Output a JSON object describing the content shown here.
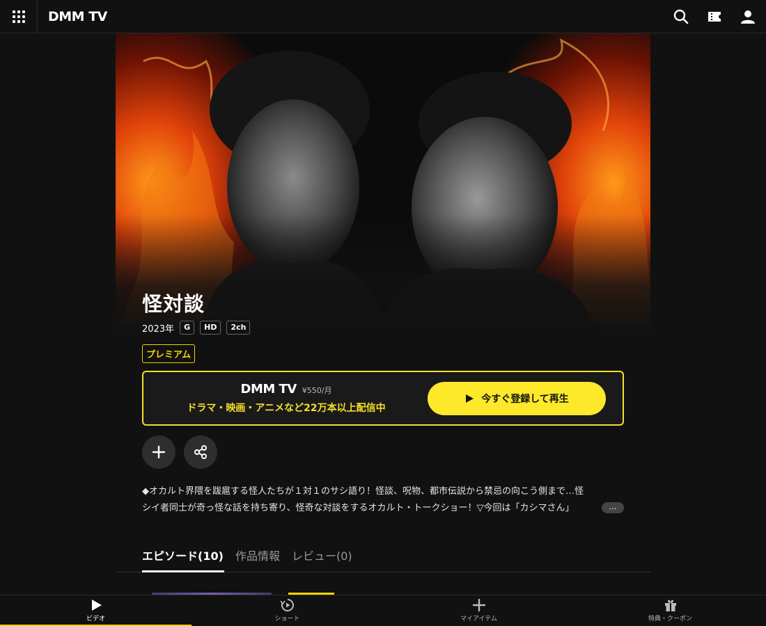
{
  "header": {
    "logo": "DMM TV",
    "icons": [
      "search-icon",
      "ticket-icon",
      "user-icon"
    ]
  },
  "title": {
    "text": "怪対談",
    "year": "2023年",
    "tags": [
      "G",
      "HD",
      "2ch"
    ],
    "premium": "プレミアム"
  },
  "signup": {
    "logo": "DMM TV",
    "price": "¥550/月",
    "desc": "ドラマ・映画・アニメなど22万本以上配信中",
    "button": "今すぐ登録して再生"
  },
  "description": {
    "line1": "◆オカルト界隈を跋扈する怪人たちが１対１のサシ語り！怪談、呪物、都市伝説から禁忌の向こう側まで…怪",
    "line2": "シイ者同士が奇っ怪な話を持ち寄り、怪奇な対談をするオカルト・トークショー！▽今回は「カシマさん」",
    "more": "…"
  },
  "tabs": {
    "episodes": "エピソード(10)",
    "info": "作品情報",
    "reviews": "レビュー(0)"
  },
  "bottom_nav": {
    "video": "ビデオ",
    "short": "ショート",
    "myitem": "マイアイテム",
    "perks": "特典・クーポン"
  },
  "colors": {
    "accent": "#f5e028",
    "background": "#111111"
  }
}
